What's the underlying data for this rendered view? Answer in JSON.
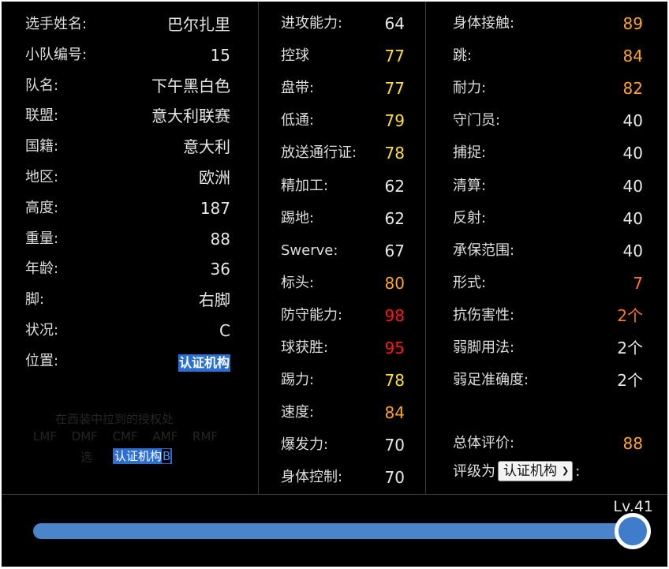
{
  "player": {
    "fields": [
      {
        "label": "选手姓名:",
        "value": "巴尔扎里"
      },
      {
        "label": "小队编号:",
        "value": "15"
      },
      {
        "label": "队名:",
        "value": "下午黑白色"
      },
      {
        "label": "联盟:",
        "value": "意大利联赛"
      },
      {
        "label": "国籍:",
        "value": "意大利"
      },
      {
        "label": "地区:",
        "value": "欧洲"
      },
      {
        "label": "高度:",
        "value": "187"
      },
      {
        "label": "重量:",
        "value": "88"
      },
      {
        "label": "年龄:",
        "value": "36"
      },
      {
        "label": "脚:",
        "value": "右脚"
      },
      {
        "label": "状况:",
        "value": "C"
      },
      {
        "label": "位置:",
        "value": "认证机构"
      }
    ],
    "position_hint": "在西装中拉到的授权处",
    "position_list": "LMF DMF CMF AMF RMF",
    "position_line3": "选",
    "position_chip": "认证机构",
    "position_chip_tail": "B"
  },
  "stats_mid": [
    {
      "label": "进攻能力:",
      "value": "64",
      "color": "#e8e8e8"
    },
    {
      "label": "控球",
      "value": "77",
      "color": "#ffe033"
    },
    {
      "label": "盘带:",
      "value": "77",
      "color": "#ffe033"
    },
    {
      "label": "低通:",
      "value": "79",
      "color": "#ffe033"
    },
    {
      "label": "放送通行证:",
      "value": "78",
      "color": "#ffe033"
    },
    {
      "label": "精加工:",
      "value": "62",
      "color": "#e8e8e8"
    },
    {
      "label": "踢地:",
      "value": "62",
      "color": "#e8e8e8"
    },
    {
      "label": "Swerve:",
      "value": "67",
      "color": "#e8e8e8"
    },
    {
      "label": "标头:",
      "value": "80",
      "color": "#ffa724"
    },
    {
      "label": "防守能力:",
      "value": "98",
      "color": "#ff1a1a"
    },
    {
      "label": "球获胜:",
      "value": "95",
      "color": "#ff1a1a"
    },
    {
      "label": "踢力:",
      "value": "78",
      "color": "#ffe033"
    },
    {
      "label": "速度:",
      "value": "84",
      "color": "#ffa724"
    },
    {
      "label": "爆发力:",
      "value": "70",
      "color": "#e8e8e8"
    },
    {
      "label": "身体控制:",
      "value": "70",
      "color": "#e8e8e8"
    }
  ],
  "stats_right": [
    {
      "label": "身体接触:",
      "value": "89",
      "color": "#ffa724"
    },
    {
      "label": "跳:",
      "value": "84",
      "color": "#ffa724"
    },
    {
      "label": "耐力:",
      "value": "82",
      "color": "#ffa724"
    },
    {
      "label": "守门员:",
      "value": "40",
      "color": "#e8e8e8"
    },
    {
      "label": "捕捉:",
      "value": "40",
      "color": "#e8e8e8"
    },
    {
      "label": "清算:",
      "value": "40",
      "color": "#e8e8e8"
    },
    {
      "label": "反射:",
      "value": "40",
      "color": "#e8e8e8"
    },
    {
      "label": "承保范围:",
      "value": "40",
      "color": "#e8e8e8"
    },
    {
      "label": "形式:",
      "value": "7",
      "color": "#ff7a1a"
    },
    {
      "label": "抗伤害性:",
      "value": "2个",
      "color": "#ff7a1a"
    },
    {
      "label": "弱脚用法:",
      "value": "2个",
      "color": "#e8e8e8"
    },
    {
      "label": "弱足准确度:",
      "value": "2个",
      "color": "#e8e8e8"
    }
  ],
  "overall": {
    "label": "总体评价:",
    "value": "88",
    "color": "#ffa724"
  },
  "grade": {
    "prefix": "评级为",
    "selected": "认证机构",
    "suffix": ":"
  },
  "level": {
    "label": "Lv.41",
    "fraction": 1.0
  }
}
